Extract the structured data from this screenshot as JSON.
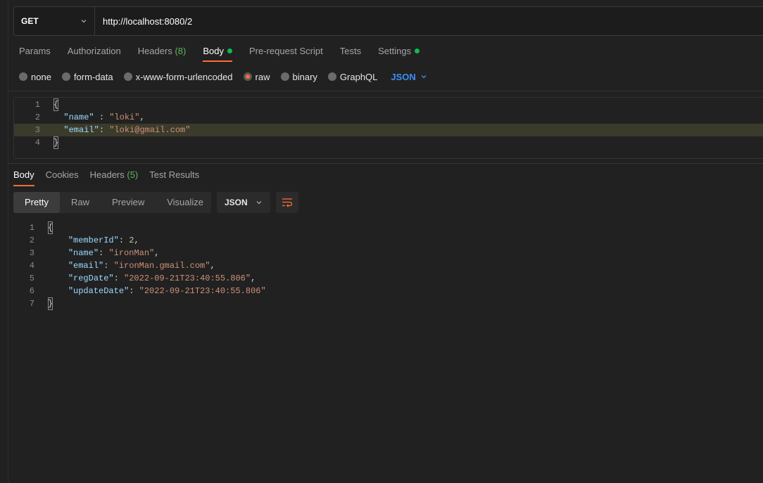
{
  "request": {
    "method": "GET",
    "url": "http://localhost:8080/2"
  },
  "request_tabs": [
    {
      "label": "Params"
    },
    {
      "label": "Authorization"
    },
    {
      "label": "Headers",
      "count": "(8)"
    },
    {
      "label": "Body"
    },
    {
      "label": "Pre-request Script"
    },
    {
      "label": "Tests"
    },
    {
      "label": "Settings"
    }
  ],
  "body_types": [
    "none",
    "form-data",
    "x-www-form-urlencoded",
    "raw",
    "binary",
    "GraphQL"
  ],
  "body_format": "JSON",
  "request_body": {
    "line_numbers": [
      "1",
      "2",
      "3",
      "4"
    ],
    "open_brace": "{",
    "close_brace": "}",
    "name_key": "\"name\"",
    "name_sep": " : ",
    "name_value": "\"loki\"",
    "email_key": "\"email\"",
    "email_sep": ": ",
    "email_value": "\"loki@gmail.com\"",
    "comma": ","
  },
  "response_tabs": [
    {
      "label": "Body"
    },
    {
      "label": "Cookies"
    },
    {
      "label": "Headers",
      "count": "(5)"
    },
    {
      "label": "Test Results"
    }
  ],
  "view_modes": [
    "Pretty",
    "Raw",
    "Preview",
    "Visualize"
  ],
  "response_format": "JSON",
  "response_body": {
    "line_numbers": [
      "1",
      "2",
      "3",
      "4",
      "5",
      "6",
      "7"
    ],
    "open_brace": "{",
    "close_brace": "}",
    "comma": ",",
    "sep": ": ",
    "memberId_key": "\"memberId\"",
    "memberId_value": "2",
    "name_key": "\"name\"",
    "name_value": "\"ironMan\"",
    "email_key": "\"email\"",
    "email_value": "\"ironMan.gmail.com\"",
    "regDate_key": "\"regDate\"",
    "regDate_value": "\"2022-09-21T23:40:55.806\"",
    "updateDate_key": "\"updateDate\"",
    "updateDate_value": "\"2022-09-21T23:40:55.806\""
  },
  "icons": {
    "method_dropdown": "chevron-down-icon",
    "format_dropdown": "chevron-down-icon",
    "wrap": "wrap-lines-icon"
  },
  "colors": {
    "accent": "#ff6c37",
    "link_blue": "#3d8ef7",
    "status_green": "#0cbb52"
  }
}
